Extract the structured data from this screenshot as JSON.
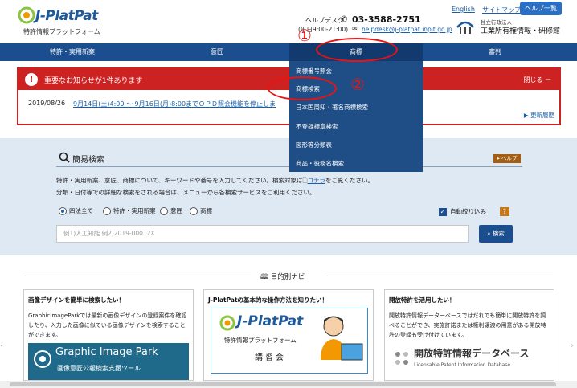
{
  "header": {
    "logo_brand": "J-PlatPat",
    "logo_sub": "特許情報プラットフォーム",
    "help_desk": "ヘルプデスク",
    "phone": "03-3588-2751",
    "hours": "(平日9:00-21:00)",
    "email": "helpdesk@j-platpat.inpit.go.jp",
    "link_english": "English",
    "link_sitemap": "サイトマップ",
    "help_list_button": "ヘルプ一覧",
    "org_small": "独立行政法人",
    "org_name": "工業所有権情報・研修館"
  },
  "nav": {
    "items": [
      "特許・実用新案",
      "意匠",
      "商標",
      "審判"
    ]
  },
  "dropdown": {
    "items": [
      "商標番号照会",
      "商標検索",
      "日本国周知・著名商標検索",
      "不登録標章検索",
      "図形等分類表",
      "商品・役務名検索"
    ]
  },
  "annotations": {
    "marker1": "①",
    "marker2": "②"
  },
  "notice": {
    "title": "重要なお知らせが1件あります",
    "close_label": "閉じる ー",
    "date": "2019/08/26",
    "text": "9月14日(土)4:00 ～ 9月16日(月)8:00までＯＰＤ照会機能を停止しま",
    "history_label": "更新履歴"
  },
  "search": {
    "title": "簡易検索",
    "help_badge": "ヘルプ",
    "desc1_pre": "特許・実用新案、意匠、商標について、キーワードや番号を入力してください。検索対象は",
    "desc1_link": "コチラ",
    "desc1_post": "をご覧ください。",
    "desc2": "分類・日付等での詳細な検索をされる場合は、メニューから各検索サービスをご利用ください。",
    "radios": [
      "四法全て",
      "特許・実用新案",
      "意匠",
      "商標"
    ],
    "radio_selected": "四法全て",
    "auto_narrow_label": "自動絞り込み",
    "auto_narrow_checked": true,
    "q_badge": "?",
    "placeholder": "例1)人工知能 例2)2019-00012X",
    "button_label": "検索"
  },
  "purpose": {
    "title": "目的別ナビ",
    "cards": [
      {
        "title": "画像デザインを簡単に検索したい！",
        "text": "GraphicImageParkでは最新の画像デザインの登録案件を確認したり、入力した画像に似ている画像デザインを検索することができます。",
        "banner_title": "Graphic Image Park",
        "banner_sub": "画像意匠公報検索支援ツール"
      },
      {
        "title": "J-PlatPatの基本的な操作方法を知りたい！",
        "banner_brand": "J-PlatPat",
        "banner_sub": "特許情報プラットフォーム",
        "banner_course": "講習会"
      },
      {
        "title": "開放特許を活用したい！",
        "text": "開放特許情報データーベースではだれでも簡単に開放特許を調べることができ、実施許諾または権利譲渡の用意がある開放特許の登録も受け付けています。",
        "banner_title": "開放特許情報データベース",
        "banner_sub": "Licensable Patent Information Database"
      }
    ]
  },
  "colors": {
    "nav_blue": "#1b4e8f",
    "alert_red": "#cc2222",
    "panel_bg": "#dfe9f4",
    "annotation_red": "#ee1111"
  }
}
